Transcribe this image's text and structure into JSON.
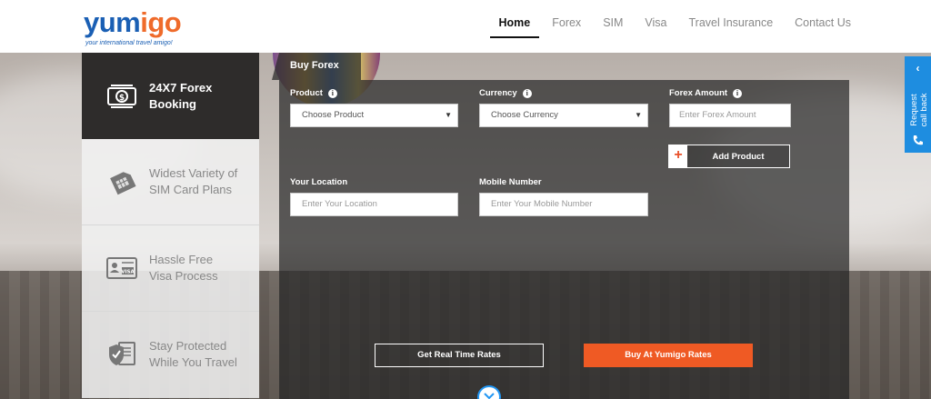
{
  "header": {
    "logo": {
      "text_part1": "yum",
      "text_part2": "i",
      "text_part3": "go",
      "tagline": "your international travel amigo!"
    },
    "nav": [
      {
        "label": "Home",
        "active": true
      },
      {
        "label": "Forex",
        "active": false
      },
      {
        "label": "SIM",
        "active": false
      },
      {
        "label": "Visa",
        "active": false
      },
      {
        "label": "Travel Insurance",
        "active": false
      },
      {
        "label": "Contact Us",
        "active": false
      }
    ]
  },
  "features": [
    {
      "label_line1": "24X7 Forex",
      "label_line2": "Booking",
      "icon": "money-icon",
      "active": true
    },
    {
      "label_line1": "Widest Variety of",
      "label_line2": "SIM Card Plans",
      "icon": "sim-card-icon",
      "active": false
    },
    {
      "label_line1": "Hassle Free",
      "label_line2": "Visa Process",
      "icon": "visa-card-icon",
      "active": false
    },
    {
      "label_line1": "Stay Protected",
      "label_line2": "While You Travel",
      "icon": "shield-icon",
      "active": false
    }
  ],
  "form": {
    "tab_title": "Buy Forex",
    "product": {
      "label": "Product",
      "value": "Choose Product"
    },
    "currency": {
      "label": "Currency",
      "value": "Choose Currency"
    },
    "forex_amount": {
      "label": "Forex Amount",
      "placeholder": "Enter Forex Amount"
    },
    "add_product_label": "Add Product",
    "location": {
      "label": "Your Location",
      "placeholder": "Enter Your Location"
    },
    "mobile": {
      "label": "Mobile Number",
      "placeholder": "Enter Your Mobile Number"
    },
    "rates_button": "Get Real Time Rates",
    "buy_button": "Buy At Yumigo Rates"
  },
  "callback": {
    "label_line1": "Request",
    "label_line2": "call back"
  },
  "colors": {
    "brand_blue": "#1a5fb4",
    "brand_orange": "#ef6b2b",
    "cta_orange": "#ef5a24",
    "callback_blue": "#1e8de0"
  }
}
